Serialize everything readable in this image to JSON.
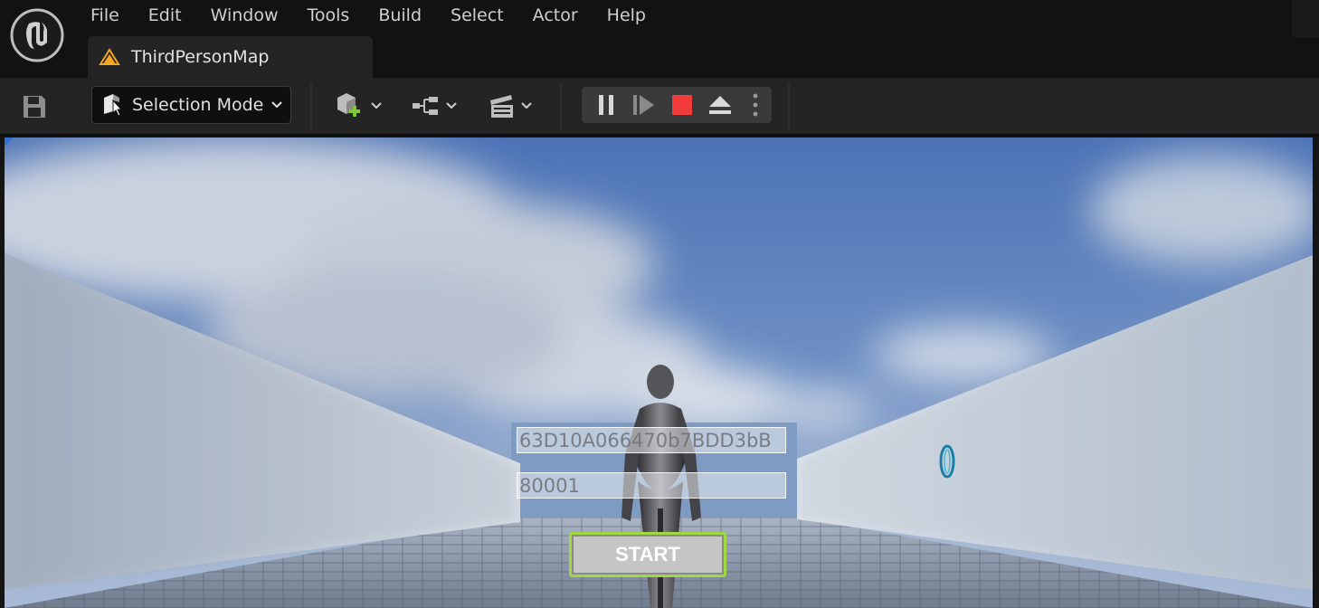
{
  "menu": [
    "File",
    "Edit",
    "Window",
    "Tools",
    "Build",
    "Select",
    "Actor",
    "Help"
  ],
  "tab": {
    "label": "ThirdPersonMap",
    "icon": "level-icon"
  },
  "toolbar": {
    "save_icon": "save-icon",
    "mode_label": "Selection Mode",
    "dropdowns": [
      "add-actor-icon",
      "blueprint-icon",
      "cinematics-icon"
    ],
    "play_controls": [
      "pause-icon",
      "step-forward-icon",
      "stop-icon",
      "eject-icon",
      "more-options-icon"
    ]
  },
  "game_ui": {
    "field1_value": "63D10A066470b7BDD3bB",
    "field2_value": "80001",
    "start_label": "START"
  },
  "colors": {
    "accent_green": "#9fd941",
    "stop_red": "#f23c3c",
    "engine_orange": "#f5a623"
  }
}
